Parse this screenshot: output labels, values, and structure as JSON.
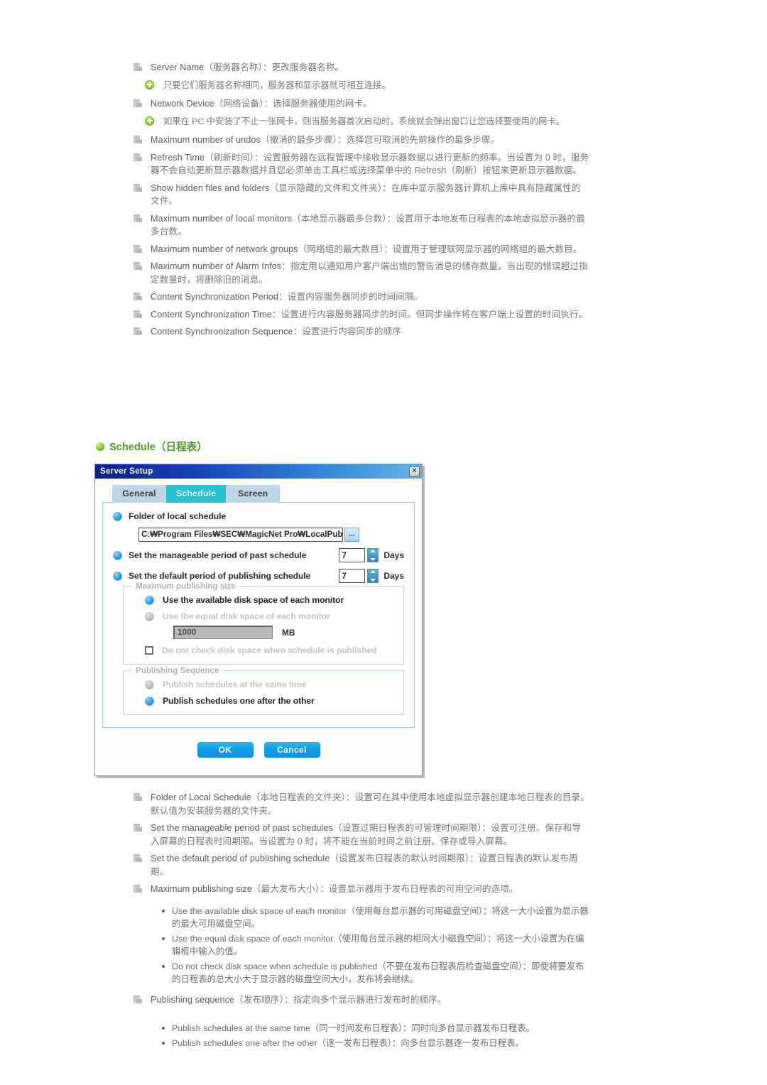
{
  "colors": {
    "heading_green": "#4c9a24",
    "tab_active": "#27c2cf",
    "button_blue": "#0fa0e6",
    "title_gradient_start": "#0c1f8c",
    "title_gradient_end": "#63b4e8"
  },
  "top_list": [
    {
      "en": "Server Name",
      "cn": "（服务器名称）：更改服务器名称。",
      "sub": [
        {
          "cn": "只要它们服务器名称相同，服务器和显示器就可相互连接。"
        }
      ]
    },
    {
      "en": "Network Device",
      "cn": "（网络设备）：选择服务器使用的网卡。",
      "sub": [
        {
          "cn": "如果在 PC 中安装了不止一张网卡，则当服务器首次启动时，系统就会弹出窗口让您选择要使用的网卡。"
        }
      ]
    },
    {
      "en": "Maximum number of undos",
      "cn": "（撤消的最多步骤）：选择您可取消的先前操作的最多步骤。",
      "sub": []
    },
    {
      "en": "Refresh Time",
      "cn": "（刷新时间）：设置服务器在远程管理中接收显示器数据以进行更新的频率。当设置为 0 时，服务器不会自动更新显示器数据并且您必须单击工具栏或选择菜单中的 Refresh（刷新）按钮来更新显示器数据。",
      "sub": []
    },
    {
      "en": "Show hidden files and folders",
      "cn": "（显示隐藏的文件和文件夹）：在库中显示服务器计算机上库中具有隐藏属性的文件。",
      "sub": []
    },
    {
      "en": "Maximum number of local monitors",
      "cn": "（本地显示器最多台数）：设置用于本地发布日程表的本地虚拟显示器的最多台数。",
      "sub": []
    },
    {
      "en": "Maximum number of network groups",
      "cn": "（网络组的最大数目）：设置用于管理联网显示器的网络组的最大数目。",
      "sub": []
    },
    {
      "en": "Maximum number of Alarm Infos",
      "cn": "：指定用以通知用户客户端出错的警告消息的储存数量。当出现的错误超过指定数量时，将删除旧的消息。",
      "sub": []
    },
    {
      "en": "Content Synchronization Period",
      "cn": "：设置内容服务器同步的时间间隔。",
      "sub": []
    },
    {
      "en": "Content Synchronization Time",
      "cn": "：设置进行内容服务器同步的时间。但同步操作将在客户端上设置的时间执行。",
      "sub": []
    },
    {
      "en": "Content Synchronization Sequence",
      "cn": "：设置进行内容同步的顺序",
      "sub": []
    }
  ],
  "heading": {
    "en": "Schedule",
    "cn": "（日程表）"
  },
  "dialog": {
    "title": "Server Setup",
    "close_label": "✕",
    "tabs": [
      {
        "label": "General",
        "active": false
      },
      {
        "label": "Schedule",
        "active": true
      },
      {
        "label": "Screen",
        "active": false
      }
    ],
    "folder_label": "Folder of local schedule",
    "folder_path": "C:₩Program Files₩SEC₩MagicNet Pro₩LocalPub",
    "browse_label": "...",
    "past_schedule_label": "Set the manageable period of past schedule",
    "past_schedule_value": "7",
    "past_schedule_unit": "Days",
    "default_period_label": "Set the default period of publishing schedule",
    "default_period_value": "7",
    "default_period_unit": "Days",
    "max_size_legend": "Maximum publishing size",
    "opt_available_disk": "Use the available disk space of each monitor",
    "opt_equal_disk": "Use the equal disk space of each monitor",
    "equal_disk_value": "1000",
    "equal_disk_unit": "MB",
    "opt_no_check": "Do not check disk space when schedule is published",
    "sequence_legend": "Publishing Sequence",
    "opt_same_time": "Publish schedules at the same time",
    "opt_one_after": "Publish schedules one after the other",
    "ok_label": "OK",
    "cancel_label": "Cancel"
  },
  "bottom_list": [
    {
      "en": "Folder of Local Schedule",
      "cn": "（本地日程表的文件夹）：设置可在其中使用本地虚拟显示器创建本地日程表的目录。默认值为安装服务器的文件夹。"
    },
    {
      "en": "Set the manageable period of past schedules",
      "cn": "（设置过期日程表的可管理时间期限）：设置可注册、保存和导入屏幕的日程表时间期限。当设置为 0 时，将不能在当前时间之前注册、保存或导入屏幕。"
    },
    {
      "en": "Set the default period of publishing schedule",
      "cn": "（设置发布日程表的默认时间期限）：设置日程表的默认发布周期。"
    },
    {
      "en": "Maximum publishing size",
      "cn": "（最大发布大小）：设置显示器用于发布日程表的可用空间的选项。"
    }
  ],
  "bottom_dots_1": [
    {
      "en": "Use the available disk space of each monitor",
      "cn": "（使用每台显示器的可用磁盘空间）：将这一大小设置为显示器的最大可用磁盘空间。"
    },
    {
      "en": "Use the equal disk space of each monitor",
      "cn": "（使用每台显示器的相同大小磁盘空间）：将这一大小设置为在编辑框中输入的值。"
    },
    {
      "en": "Do not check disk space when schedule is published",
      "cn": "（不要在发布日程表后检查磁盘空间）：即使将要发布的日程表的总大小大于显示器的磁盘空间大小，发布将会继续。"
    }
  ],
  "publishing_sequence_item": {
    "en": "Publishing sequence",
    "cn": "（发布顺序）：指定向多个显示器进行发布时的顺序。"
  },
  "bottom_dots_2": [
    {
      "en": "Publish schedules at the same time",
      "cn": "（同一时间发布日程表）：同时向多台显示器发布日程表。"
    },
    {
      "en": "Publish schedules one after the other",
      "cn": "（逐一发布日程表）：向多台显示器逐一发布日程表。"
    }
  ]
}
